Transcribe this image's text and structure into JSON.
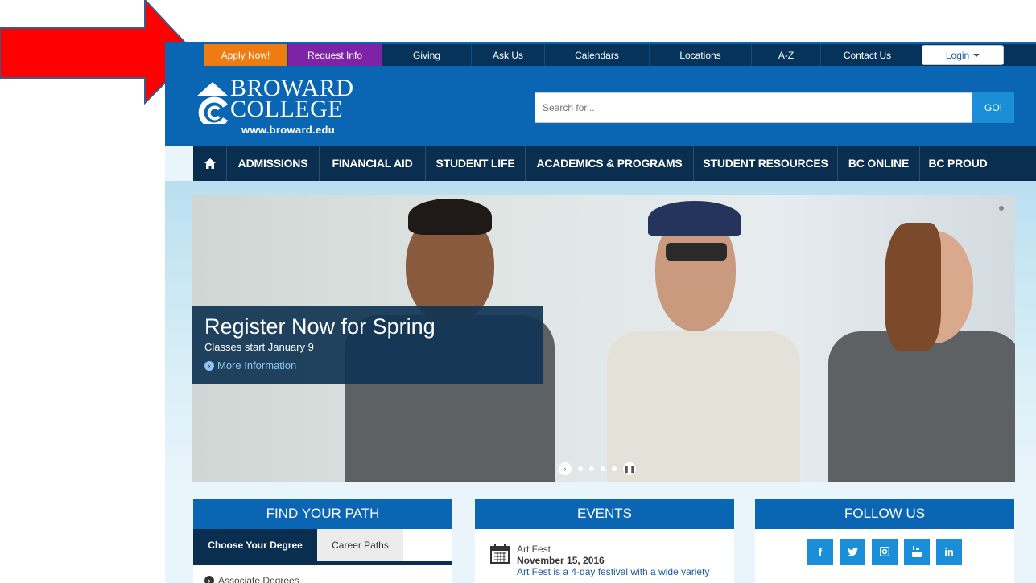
{
  "topbar": {
    "apply": "Apply Now!",
    "request": "Request Info",
    "giving": "Giving",
    "askus": "Ask Us",
    "calendars": "Calendars",
    "locations": "Locations",
    "az": "A-Z",
    "contact": "Contact Us",
    "login": "Login"
  },
  "logo": {
    "line1": "BROWARD",
    "line2": "COLLEGE",
    "url": "www.broward.edu"
  },
  "search": {
    "placeholder": "Search for...",
    "button": "GO!"
  },
  "nav": {
    "items": [
      "ADMISSIONS",
      "FINANCIAL AID",
      "STUDENT LIFE",
      "ACADEMICS & PROGRAMS",
      "STUDENT RESOURCES",
      "BC ONLINE",
      "BC PROUD"
    ]
  },
  "hero": {
    "title": "Register Now for Spring",
    "subtitle": "Classes start January 9",
    "more": "More Information"
  },
  "panels": {
    "path": {
      "title": "FIND YOUR PATH",
      "tab_active": "Choose Your Degree",
      "tab_other": "Career Paths",
      "item": "Associate Degrees"
    },
    "events": {
      "title": "EVENTS",
      "name": "Art Fest",
      "date": "November 15, 2016",
      "desc": "Art Fest is a 4-day festival with a wide variety"
    },
    "follow": {
      "title": "FOLLOW US",
      "icons": [
        "f",
        "t",
        "ig",
        "yt",
        "in"
      ]
    }
  },
  "colors": {
    "apply": "#f07c11",
    "request": "#7f23a6",
    "header_blue": "#0a66b2",
    "nav_dark": "#0a2e4f",
    "arrow_red": "#ff0000"
  }
}
